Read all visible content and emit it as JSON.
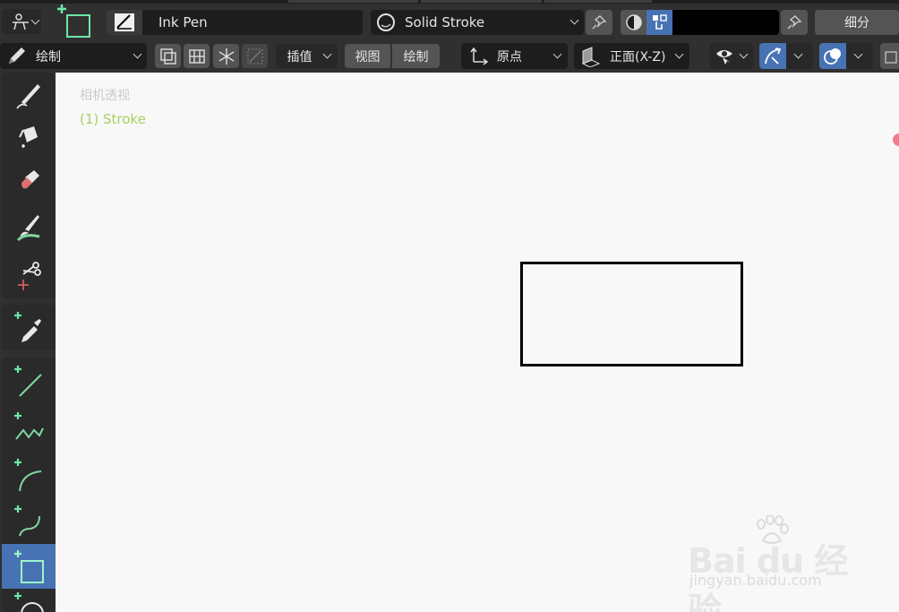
{
  "header": {
    "brush_name": "Ink Pen",
    "material_name": "Solid Stroke",
    "color_value": "#000000",
    "subdivide_label": "细分"
  },
  "toolbar_row": {
    "mode_label": "绘制",
    "interpolate_label": "插值",
    "view_tab": "视图",
    "draw_tab": "绘制",
    "pivot_label": "原点",
    "orientation_label": "正面(X-Z)"
  },
  "tools": [
    {
      "name": "draw-tool",
      "icon": "pen-icon"
    },
    {
      "name": "fill-tool",
      "icon": "bucket-icon"
    },
    {
      "name": "erase-tool",
      "icon": "eraser-icon"
    },
    {
      "name": "tint-tool",
      "icon": "brush-icon"
    },
    {
      "name": "cutter-tool",
      "icon": "scissors-icon"
    },
    {
      "name": "eyedropper-tool",
      "icon": "eyedropper-icon"
    },
    {
      "name": "line-tool",
      "icon": "line-icon"
    },
    {
      "name": "polyline-tool",
      "icon": "polyline-icon"
    },
    {
      "name": "arc-tool",
      "icon": "arc-icon"
    },
    {
      "name": "curve-tool",
      "icon": "curve-icon"
    },
    {
      "name": "box-tool",
      "icon": "box-icon"
    },
    {
      "name": "circle-tool",
      "icon": "circle-icon"
    }
  ],
  "viewport": {
    "view_name": "相机透视",
    "object_name": "(1) Stroke"
  },
  "watermark": {
    "main": "Bai du 经验",
    "sub": "jingyan.baidu.com"
  },
  "colors": {
    "accent": "#4772b3",
    "header_bg": "#303030",
    "field_bg": "#1d1d1d",
    "add_green": "#6ee7a8",
    "object_text": "#a8d060"
  }
}
